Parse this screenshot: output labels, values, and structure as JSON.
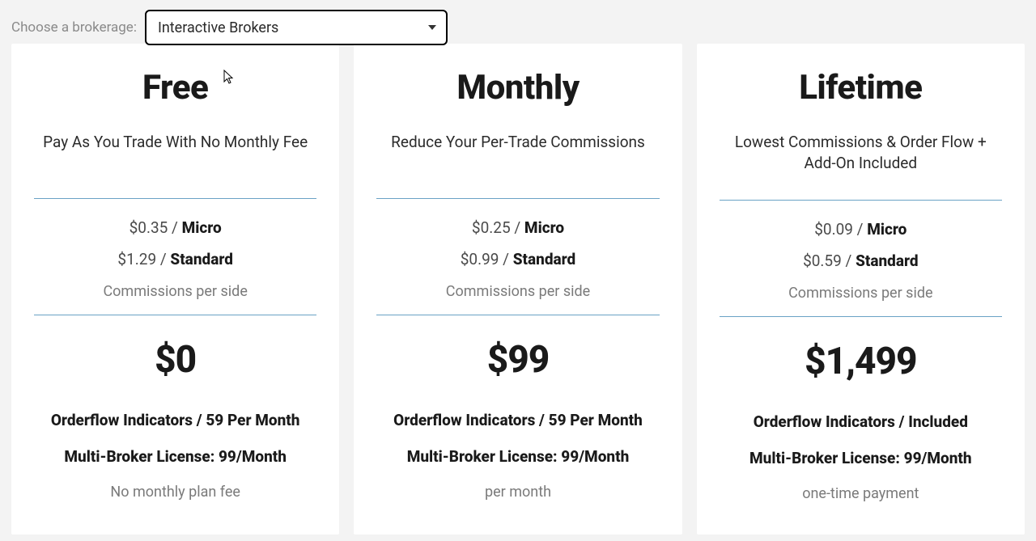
{
  "header": {
    "label": "Choose a brokerage:",
    "selected": "Interactive Brokers"
  },
  "commissions_label": "Commissions per side",
  "rate_micro_suffix": "Micro",
  "rate_standard_suffix": "Standard",
  "plans": [
    {
      "title": "Free",
      "subtitle": "Pay As You Trade With No Monthly Fee",
      "micro_price": "$0.35 / ",
      "standard_price": "$1.29 / ",
      "price": "$0",
      "feature1": "Orderflow Indicators / 59 Per Month",
      "feature2": "Multi-Broker License: 99/Month",
      "footnote": "No monthly plan fee"
    },
    {
      "title": "Monthly",
      "subtitle": "Reduce Your Per-Trade Commissions",
      "micro_price": "$0.25 / ",
      "standard_price": "$0.99 / ",
      "price": "$99",
      "feature1": "Orderflow Indicators / 59 Per Month",
      "feature2": "Multi-Broker License: 99/Month",
      "footnote": "per month"
    },
    {
      "title": "Lifetime",
      "subtitle": "Lowest Commissions & Order Flow + Add-On Included",
      "micro_price": "$0.09 / ",
      "standard_price": "$0.59 / ",
      "price": "$1,499",
      "feature1": "Orderflow Indicators / Included",
      "feature2": "Multi-Broker License: 99/Month",
      "footnote": "one-time payment"
    }
  ]
}
